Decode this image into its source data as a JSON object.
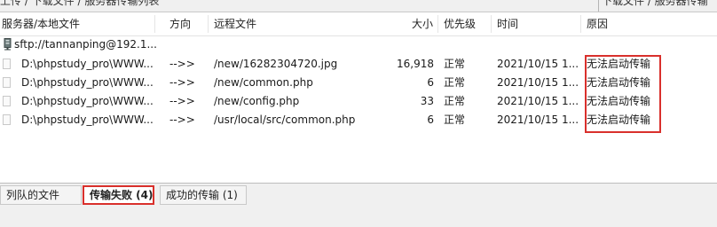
{
  "top_strip": {
    "left_fragment": "上传 / 下载文件 / 服务器传输列表",
    "right_fragment": "下载文件 / 服务器传输"
  },
  "columns": {
    "server_local": "服务器/本地文件",
    "direction": "方向",
    "remote": "远程文件",
    "size": "大小",
    "priority": "优先级",
    "time": "时间",
    "reason": "原因"
  },
  "server": {
    "label": "sftp://tannanping@192.1..."
  },
  "rows": [
    {
      "local": "D:\\phpstudy_pro\\WWW...",
      "direction": "-->>",
      "remote": "/new/16282304720.jpg",
      "size": "16,918",
      "priority": "正常",
      "time": "2021/10/15 1...",
      "reason": "无法启动传输"
    },
    {
      "local": "D:\\phpstudy_pro\\WWW...",
      "direction": "-->>",
      "remote": "/new/common.php",
      "size": "6",
      "priority": "正常",
      "time": "2021/10/15 1...",
      "reason": "无法启动传输"
    },
    {
      "local": "D:\\phpstudy_pro\\WWW...",
      "direction": "-->>",
      "remote": "/new/config.php",
      "size": "33",
      "priority": "正常",
      "time": "2021/10/15 1...",
      "reason": "无法启动传输"
    },
    {
      "local": "D:\\phpstudy_pro\\WWW...",
      "direction": "-->>",
      "remote": "/usr/local/src/common.php",
      "size": "6",
      "priority": "正常",
      "time": "2021/10/15 1...",
      "reason": "无法启动传输"
    }
  ],
  "tabs": [
    {
      "label": "列队的文件"
    },
    {
      "label": "传输失败 (4)"
    },
    {
      "label": "成功的传输 (1)"
    }
  ],
  "colors": {
    "highlight_red": "#d9302c"
  }
}
